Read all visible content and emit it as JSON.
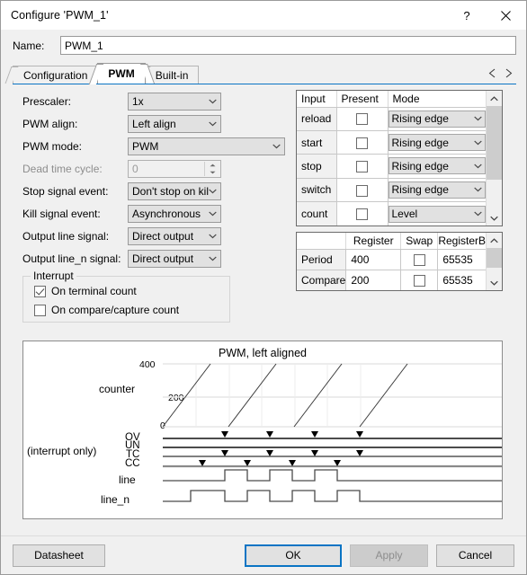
{
  "window": {
    "title": "Configure 'PWM_1'",
    "help_icon": "question-mark-icon",
    "close_icon": "close-icon"
  },
  "name_field": {
    "label": "Name:",
    "value": "PWM_1"
  },
  "tabs": {
    "items": [
      {
        "label": "Configuration",
        "active": false
      },
      {
        "label": "PWM",
        "active": true
      },
      {
        "label": "Built-in",
        "active": false
      }
    ],
    "nav_prev_icon": "triangle-left-icon",
    "nav_next_icon": "triangle-right-icon",
    "accent_color": "#0a74c4"
  },
  "form": {
    "prescaler": {
      "label": "Prescaler:",
      "value": "1x"
    },
    "pwm_align": {
      "label": "PWM align:",
      "value": "Left align"
    },
    "pwm_mode": {
      "label": "PWM mode:",
      "value": "PWM"
    },
    "dead_time_cycle": {
      "label": "Dead time cycle:",
      "value": "0"
    },
    "stop_signal_event": {
      "label": "Stop signal event:",
      "value": "Don't stop on kil"
    },
    "kill_signal_event": {
      "label": "Kill signal event:",
      "value": "Asynchronous"
    },
    "output_line_signal": {
      "label": "Output line signal:",
      "value": "Direct output"
    },
    "output_line_n_signal": {
      "label": "Output line_n signal:",
      "value": "Direct output"
    }
  },
  "interrupt": {
    "title": "Interrupt",
    "options": [
      {
        "label": "On terminal count",
        "checked": true
      },
      {
        "label": "On compare/capture count",
        "checked": false
      }
    ]
  },
  "input_table": {
    "headers": [
      "Input",
      "Present",
      "Mode"
    ],
    "rows": [
      {
        "input": "reload",
        "present": false,
        "mode": "Rising edge"
      },
      {
        "input": "start",
        "present": false,
        "mode": "Rising edge"
      },
      {
        "input": "stop",
        "present": false,
        "mode": "Rising edge"
      },
      {
        "input": "switch",
        "present": false,
        "mode": "Rising edge"
      },
      {
        "input": "count",
        "present": false,
        "mode": "Level"
      }
    ]
  },
  "register_table": {
    "headers": [
      "",
      "Register",
      "Swap",
      "RegisterB"
    ],
    "rows": [
      {
        "name": "Period",
        "register": "400",
        "swap": false,
        "register_buf": "65535"
      },
      {
        "name": "Compare",
        "register": "200",
        "swap": false,
        "register_buf": "65535"
      }
    ]
  },
  "chart_data": {
    "type": "line",
    "title": "PWM, left aligned",
    "xlabel": "",
    "ylabel": "counter",
    "ylim": [
      0,
      400
    ],
    "ytick_labels": [
      "0",
      "200",
      "400"
    ],
    "grid": true,
    "counter_label": "counter",
    "interrupt_note": "(interrupt only)",
    "signal_labels": [
      "OV",
      "UN",
      "TC",
      "CC",
      "line",
      "line_n"
    ],
    "period": 400,
    "compare": 200,
    "cycles": 4,
    "series": [
      {
        "name": "counter",
        "type": "sawtooth",
        "description": "ramps 0 to 400 each period, left aligned",
        "values": [
          0,
          400,
          0,
          400,
          0,
          400,
          0,
          400
        ]
      },
      {
        "name": "OV",
        "type": "event-markers",
        "marker_cycles": [
          1,
          2,
          3,
          4
        ]
      },
      {
        "name": "UN",
        "type": "event-markers",
        "marker_cycles": []
      },
      {
        "name": "TC",
        "type": "event-markers",
        "marker_cycles": [
          1,
          2,
          3,
          4
        ]
      },
      {
        "name": "CC",
        "type": "event-markers",
        "marker_cycles": [
          1,
          2,
          3,
          4
        ]
      },
      {
        "name": "line",
        "type": "digital",
        "duty": 0.5,
        "pulses": 3
      },
      {
        "name": "line_n",
        "type": "digital",
        "duty": 0.5,
        "pulses": 4,
        "inverted": true
      }
    ]
  },
  "buttons": {
    "datasheet": "Datasheet",
    "ok": "OK",
    "apply": "Apply",
    "cancel": "Cancel"
  }
}
